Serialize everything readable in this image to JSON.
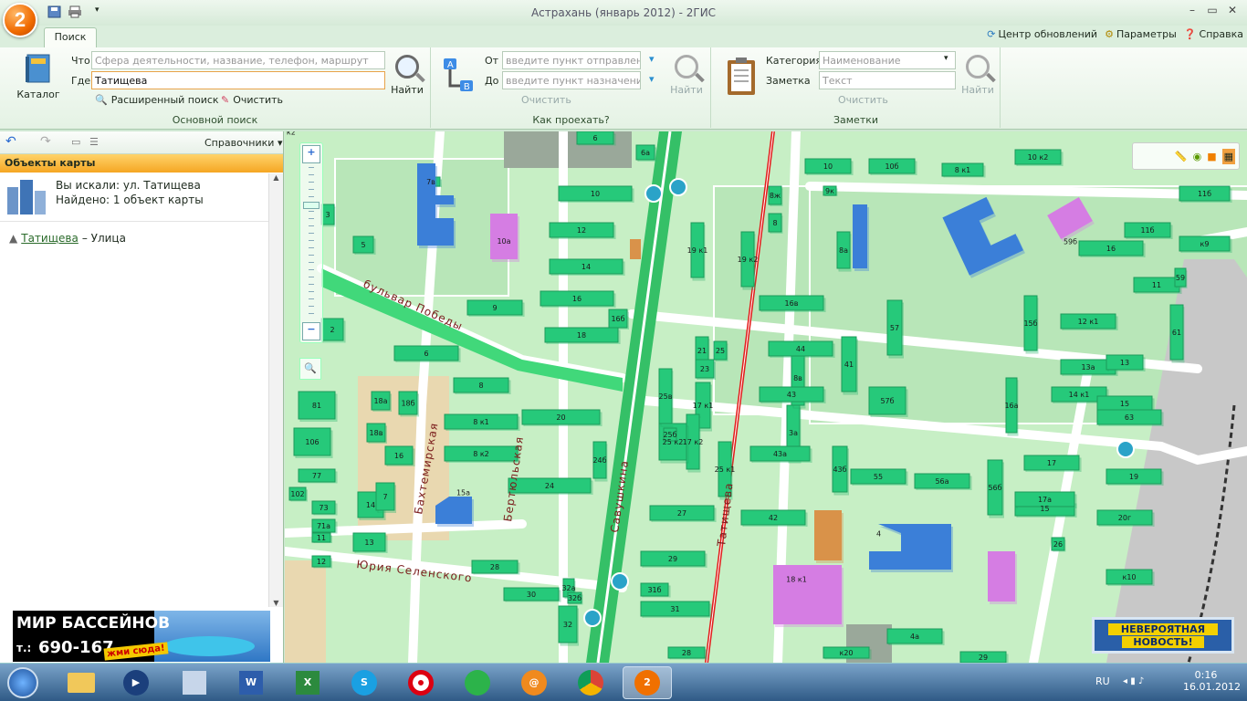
{
  "window": {
    "title": "Астрахань (январь 2012) - 2ГИС",
    "logo": "2"
  },
  "tabs": {
    "search": "Поиск"
  },
  "toplinks": {
    "updates": "Центр обновлений",
    "params": "Параметры",
    "help": "Справка"
  },
  "main_search": {
    "catalog": "Каталог",
    "what_label": "Что",
    "what_placeholder": "Сфера деятельности, название, телефон, маршрут",
    "where_label": "Где",
    "where_value": "Татищева",
    "find": "Найти",
    "advanced": "Расширенный поиск",
    "clear": "Очистить",
    "group": "Основной поиск"
  },
  "route": {
    "from_label": "От",
    "from_placeholder": "введите пункт отправления",
    "to_label": "До",
    "to_placeholder": "введите пункт назначения",
    "find": "Найти",
    "clear": "Очистить",
    "group": "Как проехать?"
  },
  "notes": {
    "category_label": "Категория",
    "category_placeholder": "Наименование",
    "note_label": "Заметка",
    "note_placeholder": "Текст",
    "find": "Найти",
    "clear": "Очистить",
    "group": "Заметки"
  },
  "left": {
    "directories": "Справочники",
    "objects_header": "Объекты карты",
    "searched": "Вы искали: ул. Татищева",
    "found": "Найдено: 1 объект карты",
    "result_link": "Татищева",
    "result_type": " – Улица"
  },
  "ad": {
    "title": "МИР БАССЕЙНОВ",
    "phone_prefix": "т.:",
    "phone": "690-167",
    "cta": "жми сюда!"
  },
  "news": {
    "line1": "НЕВЕРОЯТНАЯ",
    "line2": "НОВОСТЬ!"
  },
  "map": {
    "streets": {
      "tatishcheva": "Татищева",
      "savushkina": "Савушкина",
      "pobedy": "бульвар Победы",
      "bertyulskaya": "Бертюльская",
      "bakhtemirskaya": "Бахтемирская",
      "selenskogo": "Юрия Селенского"
    },
    "zoom_in": "+",
    "zoom_out": "−",
    "labels": [
      "6",
      "6а",
      "10",
      "10а",
      "12",
      "14",
      "16",
      "16б",
      "18",
      "7в",
      "5",
      "3",
      "9",
      "2",
      "6",
      "81",
      "106",
      "8",
      "8 к1",
      "8 к2",
      "20",
      "24",
      "24б",
      "15а",
      "14",
      "13",
      "7",
      "16",
      "18а",
      "18б",
      "18в",
      "77",
      "102",
      "73",
      "71а",
      "11",
      "12",
      "30",
      "32",
      "28",
      "32а",
      "32б",
      "17",
      "15",
      "17 к1",
      "17 к2",
      "19 к1",
      "19 к2",
      "21",
      "23",
      "25",
      "25 к1",
      "25 к2",
      "25б",
      "25в",
      "27",
      "29",
      "31",
      "33",
      "31б",
      "3а",
      "8в",
      "8ж",
      "8",
      "8а",
      "9к",
      "10",
      "10 к2",
      "10б",
      "8 к1",
      "16",
      "11б",
      "11",
      "12 к1",
      "13а",
      "13",
      "14 к1",
      "15",
      "15б",
      "16а",
      "16в",
      "44",
      "43",
      "43а",
      "42",
      "41",
      "57",
      "57б",
      "43б",
      "55",
      "56а",
      "56б",
      "17а",
      "18 к1",
      "4",
      "4а",
      "29",
      "26",
      "20г",
      "19",
      "63",
      "61",
      "59",
      "59б",
      "11б",
      "к9",
      "к10",
      "к20",
      "28",
      "33 к2"
    ]
  },
  "tray": {
    "lang": "RU",
    "time": "0:16",
    "date": "16.01.2012"
  }
}
